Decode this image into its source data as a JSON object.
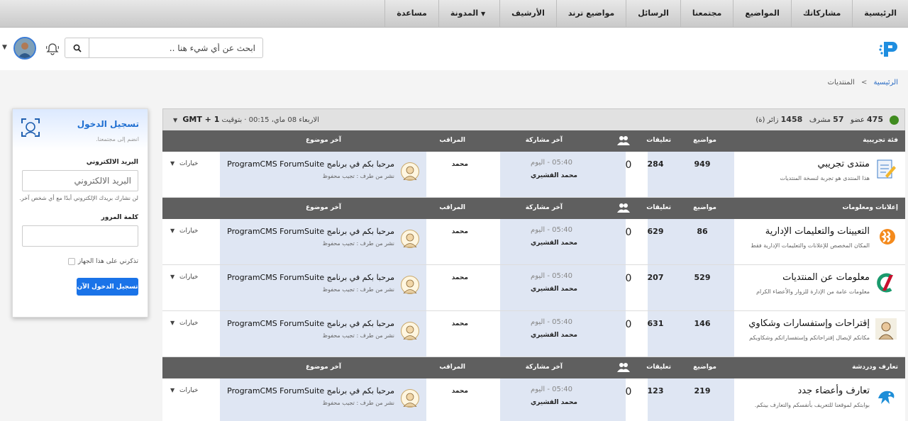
{
  "nav": {
    "items": [
      "الرئيسية",
      "مشاركاتك",
      "المواضيع",
      "مجتمعنا",
      "الرسائل",
      "مواضيع ترند",
      "الأرشيف",
      "المدونة",
      "مساعدة"
    ]
  },
  "header": {
    "search_placeholder": "ابحث عن أي شيء هنا ..",
    "icons": [
      "logo-icon",
      "search-icon",
      "bell-icon",
      "avatar"
    ]
  },
  "breadcrumb": {
    "home": "الرئيسية",
    "sep": ">",
    "current": "المنتديات"
  },
  "login": {
    "title": "تسجيل الدخول",
    "subtitle": "انضم إلى مجتمعنا.",
    "email_label": "البريد الالكتروني",
    "email_placeholder": "البريد الالكتروني",
    "email_help": "لن نشارك بريدك الإلكتروني أبدًا مع أي شخص آخر.",
    "password_label": "كلمة المرور",
    "remember": "تذكرني على هذا الجهاز",
    "submit": "تسجيل الدخول الآن"
  },
  "stats": {
    "members_num": "475",
    "members_label": "عضو",
    "mods_num": "57",
    "mods_label": "مشرف",
    "visitors_num": "1458",
    "visitors_label": "زائر (ة)",
    "time_text": "الاربعاء 08 ماي، 00:15 · بتوقيت",
    "timezone": "GMT + 1"
  },
  "columns": {
    "topics": "مواضيع",
    "comments": "تعليقات",
    "last_post": "آخر مشاركة",
    "moderator": "المراقب",
    "last_topic": "آخر موضوع"
  },
  "categories": [
    {
      "name": "فئة تجريبية",
      "forums": [
        {
          "name": "منتدى تجريبي",
          "desc": "هذا المنتدى هو تجربة لنسخة المنتديات",
          "topics": "949",
          "comments": "284",
          "online": "0",
          "lp_time": "05:40 - اليوم",
          "lp_user": "محمد القشيري",
          "moderator": "محمد",
          "lt_title": "مرحبا بكم في برنامج ProgramCMS ForumSuite",
          "lt_meta": "نشر من طرف : تجيب محفوظ",
          "options": "خيارات"
        }
      ]
    },
    {
      "name": "إعلانات ومعلومات",
      "forums": [
        {
          "name": "التعيينات والتعليمات الإدارية",
          "desc": "المكان المخصص للإعلانات والتعليمات الإدارية فقط",
          "topics": "86",
          "comments": "629",
          "online": "0",
          "lp_time": "05:40 - اليوم",
          "lp_user": "محمد القشيري",
          "moderator": "محمد",
          "lt_title": "مرحبا بكم في برنامج ProgramCMS ForumSuite",
          "lt_meta": "نشر من طرف : تجيب محفوظ",
          "options": "خيارات"
        },
        {
          "name": "معلومات عن المنتديات",
          "desc": "معلومات عامة من الإدارة للزوار والأعضاء الكرام",
          "topics": "529",
          "comments": "207",
          "online": "0",
          "lp_time": "05:40 - اليوم",
          "lp_user": "محمد القشيري",
          "moderator": "محمد",
          "lt_title": "مرحبا بكم في برنامج ProgramCMS ForumSuite",
          "lt_meta": "نشر من طرف : تجيب محفوظ",
          "options": "خيارات"
        },
        {
          "name": "إقتراحات وإستفسارات وشكاوي",
          "desc": "مكانكم لإيصال إقتراحاتكم وإستفساراتكم وشكاويكم",
          "topics": "146",
          "comments": "631",
          "online": "0",
          "lp_time": "05:40 - اليوم",
          "lp_user": "محمد القشيري",
          "moderator": "محمد",
          "lt_title": "مرحبا بكم في برنامج ProgramCMS ForumSuite",
          "lt_meta": "نشر من طرف : تجيب محفوظ",
          "options": "خيارات"
        }
      ]
    },
    {
      "name": "تعارف ودردشة",
      "forums": [
        {
          "name": "تعارف وأعضاء جدد",
          "desc": "بوابتكم لموقعنا للتعريف بأنفسكم والتعارف بينكم.",
          "topics": "219",
          "comments": "123",
          "online": "0",
          "lp_time": "05:40 - اليوم",
          "lp_user": "محمد القشيري",
          "moderator": "محمد",
          "lt_title": "مرحبا بكم في برنامج ProgramCMS ForumSuite",
          "lt_meta": "نشر من طرف : تجيب محفوظ",
          "options": "خيارات"
        }
      ]
    }
  ]
}
